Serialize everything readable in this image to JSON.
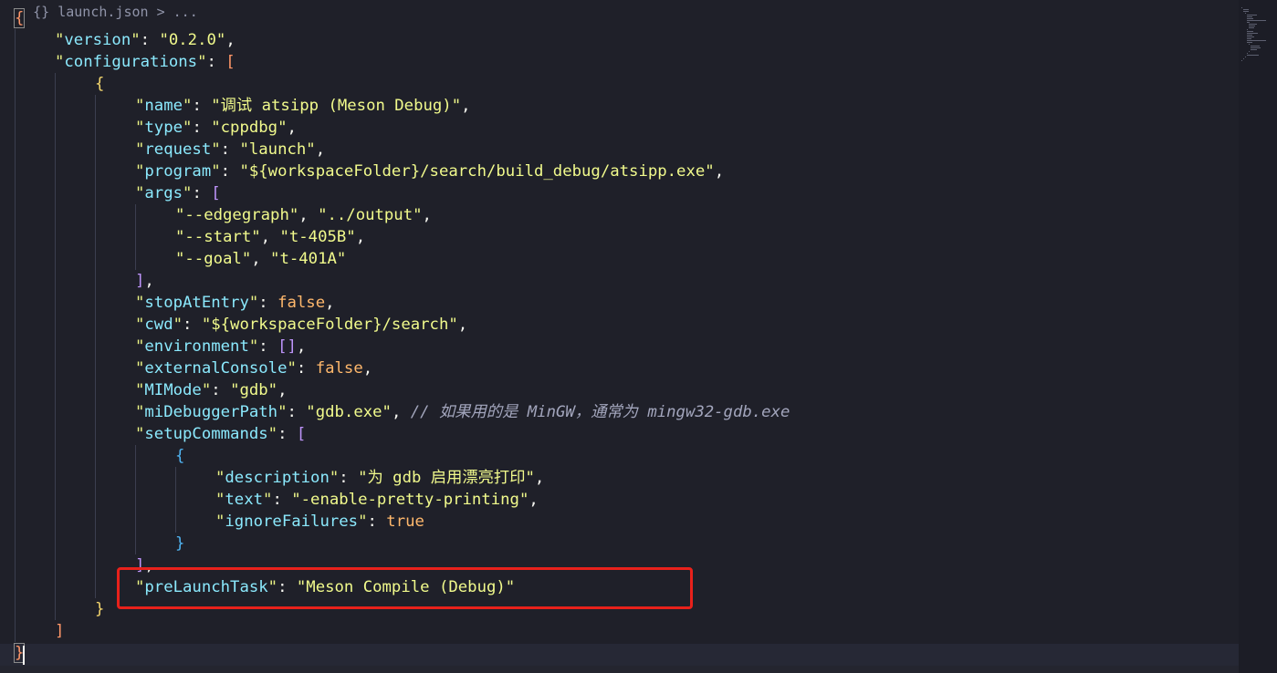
{
  "breadcrumb": {
    "text": "{} launch.json > ..."
  },
  "code_lines": [
    {
      "indent": 0,
      "tokens": [
        {
          "t": "{",
          "c": "bracket-l1 active-bracket"
        }
      ]
    },
    {
      "indent": 1,
      "tokens": [
        {
          "t": "\"",
          "c": "quote"
        },
        {
          "t": "version",
          "c": "key"
        },
        {
          "t": "\"",
          "c": "quote"
        },
        {
          "t": ": ",
          "c": "punc"
        },
        {
          "t": "\"0.2.0\"",
          "c": "str"
        },
        {
          "t": ",",
          "c": "punc"
        }
      ]
    },
    {
      "indent": 1,
      "tokens": [
        {
          "t": "\"",
          "c": "quote"
        },
        {
          "t": "configurations",
          "c": "key"
        },
        {
          "t": "\"",
          "c": "quote"
        },
        {
          "t": ": ",
          "c": "punc"
        },
        {
          "t": "[",
          "c": "bracket-l1"
        }
      ]
    },
    {
      "indent": 2,
      "tokens": [
        {
          "t": "{",
          "c": "bracket-l2"
        }
      ]
    },
    {
      "indent": 3,
      "tokens": [
        {
          "t": "\"",
          "c": "quote"
        },
        {
          "t": "name",
          "c": "key"
        },
        {
          "t": "\"",
          "c": "quote"
        },
        {
          "t": ": ",
          "c": "punc"
        },
        {
          "t": "\"调试 atsipp (Meson Debug)\"",
          "c": "str"
        },
        {
          "t": ",",
          "c": "punc"
        }
      ]
    },
    {
      "indent": 3,
      "tokens": [
        {
          "t": "\"",
          "c": "quote"
        },
        {
          "t": "type",
          "c": "key"
        },
        {
          "t": "\"",
          "c": "quote"
        },
        {
          "t": ": ",
          "c": "punc"
        },
        {
          "t": "\"cppdbg\"",
          "c": "str"
        },
        {
          "t": ",",
          "c": "punc"
        }
      ]
    },
    {
      "indent": 3,
      "tokens": [
        {
          "t": "\"",
          "c": "quote"
        },
        {
          "t": "request",
          "c": "key"
        },
        {
          "t": "\"",
          "c": "quote"
        },
        {
          "t": ": ",
          "c": "punc"
        },
        {
          "t": "\"launch\"",
          "c": "str"
        },
        {
          "t": ",",
          "c": "punc"
        }
      ]
    },
    {
      "indent": 3,
      "tokens": [
        {
          "t": "\"",
          "c": "quote"
        },
        {
          "t": "program",
          "c": "key"
        },
        {
          "t": "\"",
          "c": "quote"
        },
        {
          "t": ": ",
          "c": "punc"
        },
        {
          "t": "\"${workspaceFolder}/search/build_debug/atsipp.exe\"",
          "c": "str"
        },
        {
          "t": ",",
          "c": "punc"
        }
      ]
    },
    {
      "indent": 3,
      "tokens": [
        {
          "t": "\"",
          "c": "quote"
        },
        {
          "t": "args",
          "c": "key"
        },
        {
          "t": "\"",
          "c": "quote"
        },
        {
          "t": ": ",
          "c": "punc"
        },
        {
          "t": "[",
          "c": "bracket-l3"
        }
      ]
    },
    {
      "indent": 4,
      "tokens": [
        {
          "t": "\"--edgegraph\"",
          "c": "str"
        },
        {
          "t": ", ",
          "c": "punc"
        },
        {
          "t": "\"../output\"",
          "c": "str"
        },
        {
          "t": ",",
          "c": "punc"
        }
      ]
    },
    {
      "indent": 4,
      "tokens": [
        {
          "t": "\"--start\"",
          "c": "str"
        },
        {
          "t": ", ",
          "c": "punc"
        },
        {
          "t": "\"t-405B\"",
          "c": "str"
        },
        {
          "t": ",",
          "c": "punc"
        }
      ]
    },
    {
      "indent": 4,
      "tokens": [
        {
          "t": "\"--goal\"",
          "c": "str"
        },
        {
          "t": ", ",
          "c": "punc"
        },
        {
          "t": "\"t-401A\"",
          "c": "str"
        }
      ]
    },
    {
      "indent": 3,
      "tokens": [
        {
          "t": "]",
          "c": "bracket-l3"
        },
        {
          "t": ",",
          "c": "punc"
        }
      ]
    },
    {
      "indent": 3,
      "tokens": [
        {
          "t": "\"",
          "c": "quote"
        },
        {
          "t": "stopAtEntry",
          "c": "key"
        },
        {
          "t": "\"",
          "c": "quote"
        },
        {
          "t": ": ",
          "c": "punc"
        },
        {
          "t": "false",
          "c": "bool"
        },
        {
          "t": ",",
          "c": "punc"
        }
      ]
    },
    {
      "indent": 3,
      "tokens": [
        {
          "t": "\"",
          "c": "quote"
        },
        {
          "t": "cwd",
          "c": "key"
        },
        {
          "t": "\"",
          "c": "quote"
        },
        {
          "t": ": ",
          "c": "punc"
        },
        {
          "t": "\"${workspaceFolder}/search\"",
          "c": "str"
        },
        {
          "t": ",",
          "c": "punc"
        }
      ]
    },
    {
      "indent": 3,
      "tokens": [
        {
          "t": "\"",
          "c": "quote"
        },
        {
          "t": "environment",
          "c": "key"
        },
        {
          "t": "\"",
          "c": "quote"
        },
        {
          "t": ": ",
          "c": "punc"
        },
        {
          "t": "[]",
          "c": "bracket-l3"
        },
        {
          "t": ",",
          "c": "punc"
        }
      ]
    },
    {
      "indent": 3,
      "tokens": [
        {
          "t": "\"",
          "c": "quote"
        },
        {
          "t": "externalConsole",
          "c": "key"
        },
        {
          "t": "\"",
          "c": "quote"
        },
        {
          "t": ": ",
          "c": "punc"
        },
        {
          "t": "false",
          "c": "bool"
        },
        {
          "t": ",",
          "c": "punc"
        }
      ]
    },
    {
      "indent": 3,
      "tokens": [
        {
          "t": "\"",
          "c": "quote"
        },
        {
          "t": "MIMode",
          "c": "key"
        },
        {
          "t": "\"",
          "c": "quote"
        },
        {
          "t": ": ",
          "c": "punc"
        },
        {
          "t": "\"gdb\"",
          "c": "str"
        },
        {
          "t": ",",
          "c": "punc"
        }
      ]
    },
    {
      "indent": 3,
      "tokens": [
        {
          "t": "\"",
          "c": "quote"
        },
        {
          "t": "miDebuggerPath",
          "c": "key"
        },
        {
          "t": "\"",
          "c": "quote"
        },
        {
          "t": ": ",
          "c": "punc"
        },
        {
          "t": "\"gdb.exe\"",
          "c": "str"
        },
        {
          "t": ", ",
          "c": "punc"
        },
        {
          "t": "// 如果用的是 MinGW，通常为 mingw32-gdb.exe",
          "c": "comment"
        }
      ]
    },
    {
      "indent": 3,
      "tokens": [
        {
          "t": "\"",
          "c": "quote"
        },
        {
          "t": "setupCommands",
          "c": "key"
        },
        {
          "t": "\"",
          "c": "quote"
        },
        {
          "t": ": ",
          "c": "punc"
        },
        {
          "t": "[",
          "c": "bracket-l3"
        }
      ]
    },
    {
      "indent": 4,
      "tokens": [
        {
          "t": "{",
          "c": "bracket-l4"
        }
      ]
    },
    {
      "indent": 5,
      "tokens": [
        {
          "t": "\"",
          "c": "quote"
        },
        {
          "t": "description",
          "c": "key"
        },
        {
          "t": "\"",
          "c": "quote"
        },
        {
          "t": ": ",
          "c": "punc"
        },
        {
          "t": "\"为 gdb 启用漂亮打印\"",
          "c": "str"
        },
        {
          "t": ",",
          "c": "punc"
        }
      ]
    },
    {
      "indent": 5,
      "tokens": [
        {
          "t": "\"",
          "c": "quote"
        },
        {
          "t": "text",
          "c": "key"
        },
        {
          "t": "\"",
          "c": "quote"
        },
        {
          "t": ": ",
          "c": "punc"
        },
        {
          "t": "\"-enable-pretty-printing\"",
          "c": "str"
        },
        {
          "t": ",",
          "c": "punc"
        }
      ]
    },
    {
      "indent": 5,
      "tokens": [
        {
          "t": "\"",
          "c": "quote"
        },
        {
          "t": "ignoreFailures",
          "c": "key"
        },
        {
          "t": "\"",
          "c": "quote"
        },
        {
          "t": ": ",
          "c": "punc"
        },
        {
          "t": "true",
          "c": "bool"
        }
      ]
    },
    {
      "indent": 4,
      "tokens": [
        {
          "t": "}",
          "c": "bracket-l4"
        }
      ]
    },
    {
      "indent": 3,
      "tokens": [
        {
          "t": "]",
          "c": "bracket-l3"
        },
        {
          "t": ",",
          "c": "punc"
        }
      ]
    },
    {
      "indent": 3,
      "tokens": [
        {
          "t": "\"",
          "c": "quote"
        },
        {
          "t": "preLaunchTask",
          "c": "key"
        },
        {
          "t": "\"",
          "c": "quote"
        },
        {
          "t": ": ",
          "c": "punc"
        },
        {
          "t": "\"Meson Compile (Debug)\"",
          "c": "str"
        }
      ]
    },
    {
      "indent": 2,
      "tokens": [
        {
          "t": "}",
          "c": "bracket-l2"
        }
      ]
    },
    {
      "indent": 1,
      "tokens": [
        {
          "t": "]",
          "c": "bracket-l1"
        }
      ]
    },
    {
      "indent": 0,
      "tokens": [
        {
          "t": "}",
          "c": "bracket-l1 active-bracket"
        }
      ]
    }
  ],
  "annotation": {
    "color": "#e8211b"
  },
  "colors": {
    "background": "#1f2029",
    "key": "#8be9fd",
    "string": "#f1fa8c",
    "boolean": "#ffb86c",
    "comment": "#a3a6bd"
  }
}
